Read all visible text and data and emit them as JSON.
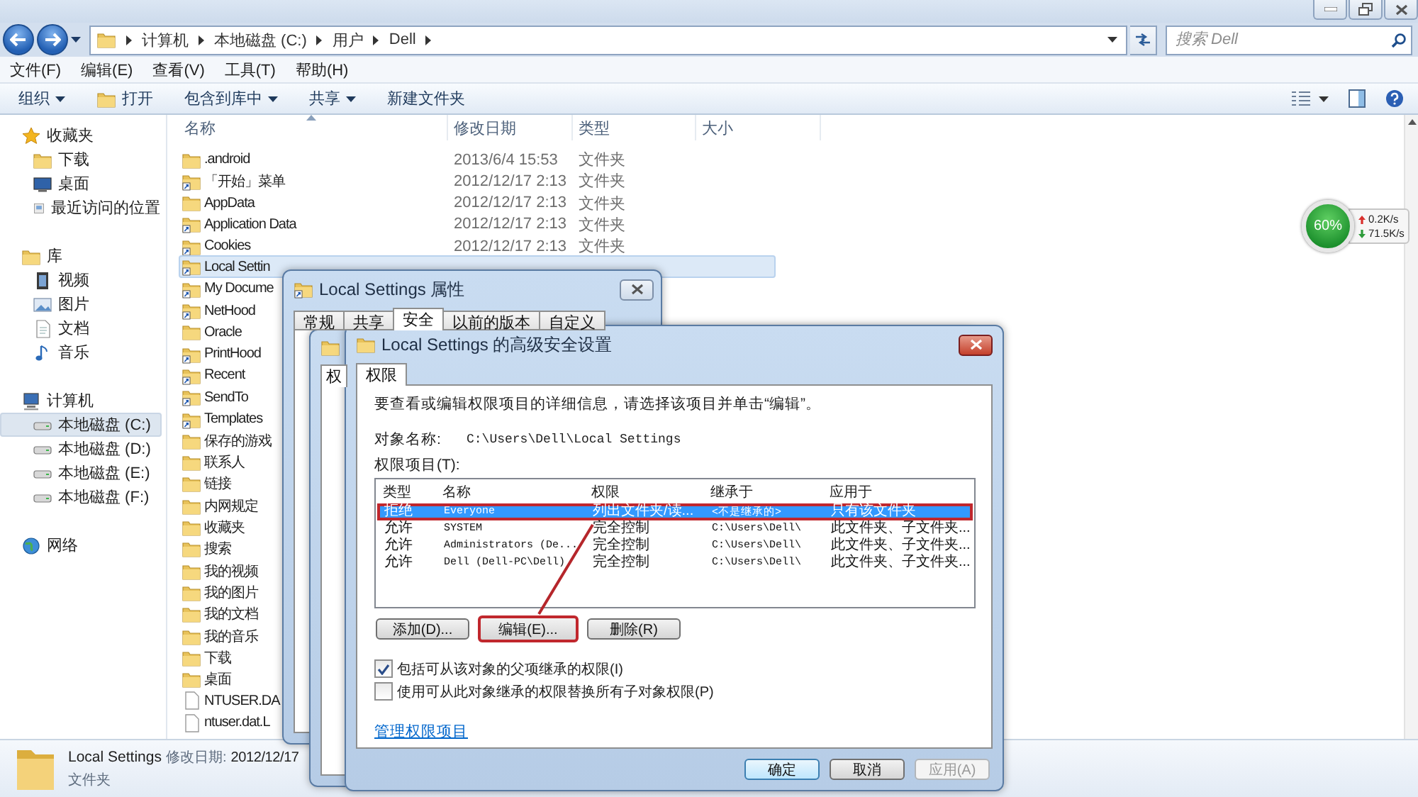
{
  "address_bar": {
    "path": [
      "计算机",
      "本地磁盘 (C:)",
      "用户",
      "Dell"
    ]
  },
  "search": {
    "placeholder": "搜索 Dell"
  },
  "menu": [
    "文件(F)",
    "编辑(E)",
    "查看(V)",
    "工具(T)",
    "帮助(H)"
  ],
  "toolbar": [
    {
      "label": "组织",
      "kind": "dropdown"
    },
    {
      "label": "打开",
      "kind": "icon"
    },
    {
      "label": "包含到库中",
      "kind": "dropdown"
    },
    {
      "label": "共享",
      "kind": "dropdown"
    },
    {
      "label": "新建文件夹",
      "kind": "plain"
    }
  ],
  "sidebar": [
    {
      "label": "收藏夹",
      "selected": false,
      "children": [
        {
          "label": "下载",
          "selected": false
        },
        {
          "label": "桌面",
          "selected": false
        },
        {
          "label": "最近访问的位置",
          "selected": false
        }
      ]
    },
    {
      "label": "库",
      "selected": false,
      "children": [
        {
          "label": "视频",
          "selected": false
        },
        {
          "label": "图片",
          "selected": false
        },
        {
          "label": "文档",
          "selected": false
        },
        {
          "label": "音乐",
          "selected": false
        }
      ]
    },
    {
      "label": "计算机",
      "selected": false,
      "children": [
        {
          "label": "本地磁盘 (C:)",
          "selected": true
        },
        {
          "label": "本地磁盘 (D:)",
          "selected": false
        },
        {
          "label": "本地磁盘 (E:)",
          "selected": false
        },
        {
          "label": "本地磁盘 (F:)",
          "selected": false
        }
      ]
    },
    {
      "label": "网络",
      "selected": false
    }
  ],
  "file_list": {
    "columns": [
      "名称",
      "修改日期",
      "类型",
      "大小"
    ],
    "rows": [
      {
        "name": ".android",
        "modified": "2013/6/4 15:53",
        "type": "文件夹",
        "kind": "folder",
        "selected": false
      },
      {
        "name": "「开始」菜单",
        "modified": "2012/12/17 2:13",
        "type": "文件夹",
        "kind": "shortcut",
        "selected": false
      },
      {
        "name": "AppData",
        "modified": "2012/12/17 2:13",
        "type": "文件夹",
        "kind": "folder",
        "selected": false
      },
      {
        "name": "Application Data",
        "modified": "2012/12/17 2:13",
        "type": "文件夹",
        "kind": "shortcut",
        "selected": false
      },
      {
        "name": "Cookies",
        "modified": "2012/12/17 2:13",
        "type": "文件夹",
        "kind": "shortcut",
        "selected": false
      },
      {
        "name": "Local Settin",
        "kind": "shortcut",
        "selected": true
      },
      {
        "name": "My Docume",
        "kind": "shortcut",
        "selected": false
      },
      {
        "name": "NetHood",
        "kind": "shortcut",
        "selected": false
      },
      {
        "name": "Oracle",
        "kind": "folder",
        "selected": false
      },
      {
        "name": "PrintHood",
        "kind": "shortcut",
        "selected": false
      },
      {
        "name": "Recent",
        "kind": "shortcut",
        "selected": false
      },
      {
        "name": "SendTo",
        "kind": "shortcut",
        "selected": false
      },
      {
        "name": "Templates",
        "kind": "shortcut",
        "selected": false
      },
      {
        "name": "保存的游戏",
        "kind": "folder",
        "selected": false
      },
      {
        "name": "联系人",
        "kind": "folder",
        "selected": false
      },
      {
        "name": "链接",
        "kind": "folder",
        "selected": false
      },
      {
        "name": "内网规定",
        "kind": "folder",
        "selected": false
      },
      {
        "name": "收藏夹",
        "kind": "folder",
        "selected": false
      },
      {
        "name": "搜索",
        "kind": "folder",
        "selected": false
      },
      {
        "name": "我的视频",
        "kind": "folder",
        "selected": false
      },
      {
        "name": "我的图片",
        "kind": "folder",
        "selected": false
      },
      {
        "name": "我的文档",
        "kind": "folder",
        "selected": false
      },
      {
        "name": "我的音乐",
        "kind": "folder",
        "selected": false
      },
      {
        "name": "下载",
        "kind": "folder",
        "selected": false
      },
      {
        "name": "桌面",
        "kind": "folder",
        "selected": false
      },
      {
        "name": "NTUSER.DA",
        "kind": "file",
        "selected": false
      },
      {
        "name": "ntuser.dat.L",
        "kind": "file",
        "selected": false
      }
    ]
  },
  "details_pane": {
    "name": "Local Settings",
    "modified_label": "修改日期:",
    "modified": "2012/12/17",
    "type": "文件夹"
  },
  "network_meter": {
    "percent": "60%",
    "upload": "0.2K/s",
    "download": "71.5K/s"
  },
  "properties_dialog": {
    "title": "Local Settings 属性",
    "tabs": [
      {
        "label": "常规",
        "selected": false
      },
      {
        "label": "共享",
        "selected": false
      },
      {
        "label": "安全",
        "selected": true
      },
      {
        "label": "以前的版本",
        "selected": false
      },
      {
        "label": "自定义",
        "selected": false
      }
    ]
  },
  "middle_dialog": {
    "tabs": [
      {
        "label": "权",
        "selected": true
      }
    ]
  },
  "advanced_dialog": {
    "title": "Local Settings 的高级安全设置",
    "tabs": [
      {
        "label": "权限",
        "selected": true
      }
    ],
    "instruction": "要查看或编辑权限项目的详细信息，请选择该项目并单击“编辑”。",
    "object_label": "对象名称:",
    "object_name": "C:\\Users\\Dell\\Local Settings",
    "entries_label": "权限项目(T):",
    "columns": [
      "类型",
      "名称",
      "权限",
      "继承于",
      "应用于"
    ],
    "entries": [
      {
        "type": "拒绝",
        "name": "Everyone",
        "permission": "列出文件夹/读...",
        "inherited_from": "<不是继承的>",
        "applies_to": "只有该文件夹",
        "selected": true,
        "highlighted": true
      },
      {
        "type": "允许",
        "name": "SYSTEM",
        "permission": "完全控制",
        "inherited_from": "C:\\Users\\Dell\\",
        "applies_to": "此文件夹、子文件夹...",
        "selected": false,
        "highlighted": false
      },
      {
        "type": "允许",
        "name": "Administrators (De...",
        "permission": "完全控制",
        "inherited_from": "C:\\Users\\Dell\\",
        "applies_to": "此文件夹、子文件夹...",
        "selected": false,
        "highlighted": false
      },
      {
        "type": "允许",
        "name": "Dell (Dell-PC\\Dell)",
        "permission": "完全控制",
        "inherited_from": "C:\\Users\\Dell\\",
        "applies_to": "此文件夹、子文件夹...",
        "selected": false,
        "highlighted": false
      }
    ],
    "buttons": [
      {
        "label": "添加(D)...",
        "highlighted": false
      },
      {
        "label": "编辑(E)...",
        "highlighted": true
      },
      {
        "label": "删除(R)",
        "highlighted": false
      }
    ],
    "checkboxes": [
      {
        "label": "包括可从该对象的父项继承的权限(I)",
        "checked": true
      },
      {
        "label": "使用可从此对象继承的权限替换所有子对象权限(P)",
        "checked": false
      }
    ],
    "link": "管理权限项目",
    "footer_buttons": [
      {
        "label": "确定",
        "default": true,
        "disabled": false
      },
      {
        "label": "取消",
        "default": false,
        "disabled": false
      },
      {
        "label": "应用(A)",
        "default": false,
        "disabled": true
      }
    ]
  }
}
